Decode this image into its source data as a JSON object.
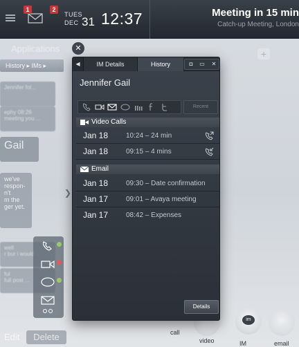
{
  "topbar": {
    "badge_im": "1",
    "badge_email": "2",
    "date_dow": "TUES",
    "date_month": "DEC",
    "date_day": "31",
    "time": "12:37",
    "meeting_title": "Meeting in 15 min",
    "meeting_sub": "Catch-up Meeting, London"
  },
  "background": {
    "header": "Applications",
    "breadcrumb": "History ▸ IMs ▸",
    "cards": [
      "Jennifer fol...",
      "ephy 08:26",
      "meeting you ...",
      "Gail",
      "we've",
      "respon-",
      "n't",
      "m the",
      "ger yet.",
      "well",
      "r bur i would ...",
      "ful",
      "full post ..."
    ],
    "bottom_edit": "Edit",
    "bottom_delete": "Delete",
    "dock_call": "call",
    "dock_video": "video",
    "dock_im": "IM",
    "dock_email": "email",
    "dock_im_glyph": "im"
  },
  "panel": {
    "tab_details": "IM Details",
    "tab_history": "History",
    "contact_name": "Jennifer Gail",
    "recent_label": "Recent",
    "details_button": "Details",
    "sections": [
      {
        "title": "Video Calls",
        "rows": [
          {
            "date": "Jan 18",
            "text": "10:24 – 24 min",
            "icon": "outgoing-call-icon"
          },
          {
            "date": "Jan 18",
            "text": "09:15 – 4 mins",
            "icon": "incoming-call-icon"
          }
        ]
      },
      {
        "title": "Email",
        "rows": [
          {
            "date": "Jan 18",
            "text": "09:30 – Date confirmation"
          },
          {
            "date": "Jan 17",
            "text": "09:01 – Avaya meeting"
          },
          {
            "date": "Jan 17",
            "text": "08:42 – Expenses"
          }
        ]
      }
    ]
  },
  "colors": {
    "topbar": "#23282f",
    "panel": "#2b3038",
    "section": "#4b525b",
    "badge": "#c9353a"
  }
}
